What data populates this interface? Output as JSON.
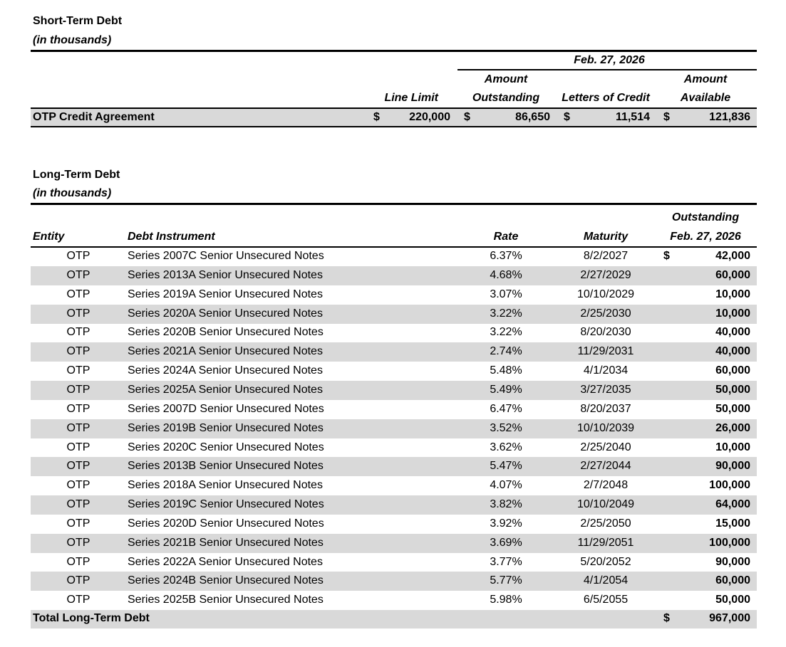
{
  "short_term": {
    "title": "Short-Term Debt",
    "subtitle": "(in thousands)",
    "date_header": "Feb. 27, 2026",
    "col_line_limit": "Line Limit",
    "col_amount_outstanding_1": "Amount",
    "col_amount_outstanding_2": "Outstanding",
    "col_letters_of_credit": "Letters of Credit",
    "col_amount_available_1": "Amount",
    "col_amount_available_2": "Available",
    "row": {
      "label": "OTP Credit Agreement",
      "currency": "$",
      "line_limit": "220,000",
      "amount_outstanding": "86,650",
      "letters_of_credit": "11,514",
      "amount_available": "121,836"
    }
  },
  "long_term": {
    "title": "Long-Term Debt",
    "subtitle": "(in thousands)",
    "col_entity": "Entity",
    "col_instrument": "Debt Instrument",
    "col_rate": "Rate",
    "col_maturity": "Maturity",
    "col_outstanding_1": "Outstanding",
    "col_outstanding_2": "Feb. 27, 2026",
    "currency": "$",
    "rows": [
      {
        "entity": "OTP",
        "instrument": "Series 2007C Senior Unsecured Notes",
        "rate": "6.37%",
        "maturity": "8/2/2027",
        "outstanding": "42,000"
      },
      {
        "entity": "OTP",
        "instrument": "Series 2013A Senior Unsecured Notes",
        "rate": "4.68%",
        "maturity": "2/27/2029",
        "outstanding": "60,000"
      },
      {
        "entity": "OTP",
        "instrument": "Series 2019A Senior Unsecured Notes",
        "rate": "3.07%",
        "maturity": "10/10/2029",
        "outstanding": "10,000"
      },
      {
        "entity": "OTP",
        "instrument": "Series 2020A Senior Unsecured Notes",
        "rate": "3.22%",
        "maturity": "2/25/2030",
        "outstanding": "10,000"
      },
      {
        "entity": "OTP",
        "instrument": "Series 2020B Senior Unsecured Notes",
        "rate": "3.22%",
        "maturity": "8/20/2030",
        "outstanding": "40,000"
      },
      {
        "entity": "OTP",
        "instrument": "Series 2021A Senior Unsecured Notes",
        "rate": "2.74%",
        "maturity": "11/29/2031",
        "outstanding": "40,000"
      },
      {
        "entity": "OTP",
        "instrument": "Series 2024A Senior Unsecured Notes",
        "rate": "5.48%",
        "maturity": "4/1/2034",
        "outstanding": "60,000"
      },
      {
        "entity": "OTP",
        "instrument": "Series 2025A Senior Unsecured Notes",
        "rate": "5.49%",
        "maturity": "3/27/2035",
        "outstanding": "50,000"
      },
      {
        "entity": "OTP",
        "instrument": "Series 2007D Senior Unsecured Notes",
        "rate": "6.47%",
        "maturity": "8/20/2037",
        "outstanding": "50,000"
      },
      {
        "entity": "OTP",
        "instrument": "Series 2019B Senior Unsecured Notes",
        "rate": "3.52%",
        "maturity": "10/10/2039",
        "outstanding": "26,000"
      },
      {
        "entity": "OTP",
        "instrument": "Series 2020C Senior Unsecured Notes",
        "rate": "3.62%",
        "maturity": "2/25/2040",
        "outstanding": "10,000"
      },
      {
        "entity": "OTP",
        "instrument": "Series 2013B Senior Unsecured Notes",
        "rate": "5.47%",
        "maturity": "2/27/2044",
        "outstanding": "90,000"
      },
      {
        "entity": "OTP",
        "instrument": "Series 2018A Senior Unsecured Notes",
        "rate": "4.07%",
        "maturity": "2/7/2048",
        "outstanding": "100,000"
      },
      {
        "entity": "OTP",
        "instrument": "Series 2019C Senior Unsecured Notes",
        "rate": "3.82%",
        "maturity": "10/10/2049",
        "outstanding": "64,000"
      },
      {
        "entity": "OTP",
        "instrument": "Series 2020D Senior Unsecured Notes",
        "rate": "3.92%",
        "maturity": "2/25/2050",
        "outstanding": "15,000"
      },
      {
        "entity": "OTP",
        "instrument": "Series 2021B Senior Unsecured Notes",
        "rate": "3.69%",
        "maturity": "11/29/2051",
        "outstanding": "100,000"
      },
      {
        "entity": "OTP",
        "instrument": "Series 2022A Senior Unsecured Notes",
        "rate": "3.77%",
        "maturity": "5/20/2052",
        "outstanding": "90,000"
      },
      {
        "entity": "OTP",
        "instrument": "Series 2024B Senior Unsecured Notes",
        "rate": "5.77%",
        "maturity": "4/1/2054",
        "outstanding": "60,000"
      },
      {
        "entity": "OTP",
        "instrument": "Series 2025B Senior Unsecured Notes",
        "rate": "5.98%",
        "maturity": "6/5/2055",
        "outstanding": "50,000"
      }
    ],
    "total": {
      "label": "Total Long-Term Debt",
      "currency": "$",
      "value": "967,000"
    }
  }
}
